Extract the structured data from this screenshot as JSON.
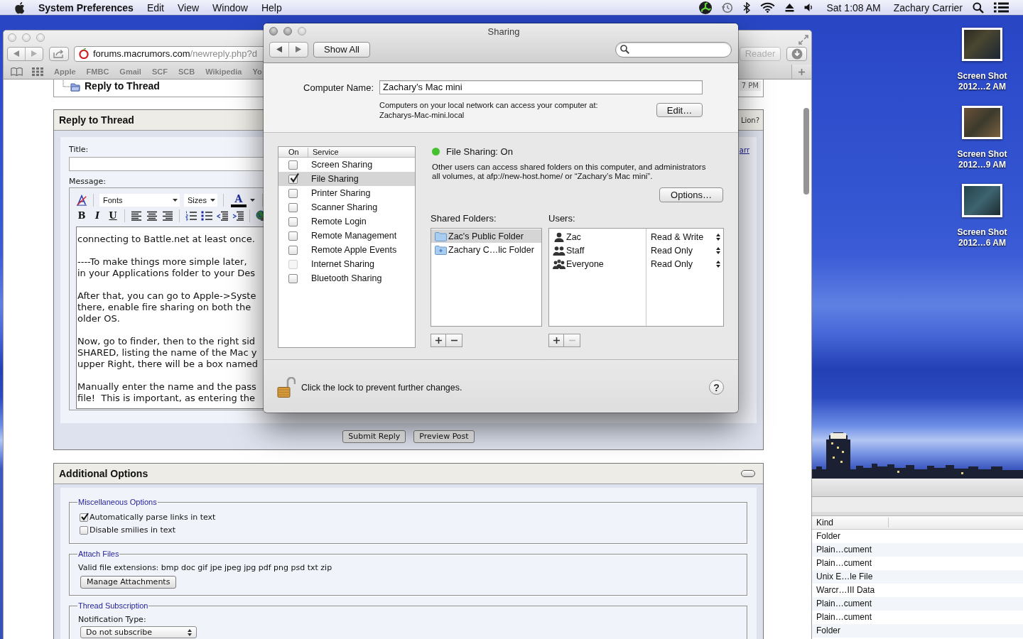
{
  "menu_bar": {
    "app_name": "System Preferences",
    "menus": [
      "Edit",
      "View",
      "Window",
      "Help"
    ],
    "clock": "Sat 1:08 AM",
    "user": "Zachary Carrier"
  },
  "desktop_icons": [
    {
      "name_line": "Screen Shot",
      "date_line": "2012…2 AM"
    },
    {
      "name_line": "Screen Shot",
      "date_line": "2012…9 AM"
    },
    {
      "name_line": "Screen Shot",
      "date_line": "2012…6 AM"
    }
  ],
  "finder": {
    "column": "Kind",
    "rows": [
      "Folder",
      "Plain…cument",
      "Plain…cument",
      "Unix E…le File",
      "Warcr…III Data",
      "Plain…cument",
      "Plain…cument",
      "Folder"
    ]
  },
  "browser": {
    "url_host": "forums.macrumors.com",
    "url_path": "/newreply.php?d",
    "reader_button": "Reader",
    "reader_disabled": true,
    "bookmarks": [
      "Apple",
      "FMBC",
      "Gmail",
      "SCF",
      "SCB",
      "Wikipedia",
      "Yo"
    ],
    "page": {
      "breadcrumb": "Reply to Thread",
      "breadcrumb_time": "7 PM",
      "reply_panel": {
        "title": "Reply to Thread",
        "title_side": "Lion?",
        "side_link": "arr",
        "title_label": "Title:",
        "message_label": "Message:",
        "font_select": "Fonts",
        "size_select": "Sizes",
        "color_button": "A",
        "format_buttons": [
          {
            "label": "B",
            "kind": "bold"
          },
          {
            "label": "I",
            "kind": "italic"
          },
          {
            "label": "U",
            "kind": "underline"
          }
        ],
        "message_paragraphs": [
          [
            "connecting to Battle.net at least once."
          ],
          [
            "----To make things more simple later,",
            "in your Applications folder to your Des"
          ],
          [
            "After that, you can go to Apple->Syste",
            "there, enable fire sharing on both the",
            "older OS."
          ],
          [
            "Now, go to finder, then to the right sid",
            "SHARED, listing the name of the Mac y",
            "upper Right, there will be a box named"
          ],
          [
            "Manually enter the name and the pass",
            "file!  This is important, as entering the"
          ]
        ],
        "buttons": [
          "Submit Reply",
          "Preview Post"
        ]
      },
      "options_panel": {
        "title": "Additional Options",
        "fieldsets": [
          {
            "legend": "Miscellaneous Options",
            "kind": "checkboxes",
            "items": [
              {
                "label": "Automatically parse links in text",
                "checked": true
              },
              {
                "label": "Disable smilies in text",
                "checked": false
              }
            ]
          },
          {
            "legend": "Attach Files",
            "kind": "attachments",
            "text": "Valid file extensions: bmp doc gif jpe jpeg jpg pdf png psd txt zip",
            "button": "Manage Attachments"
          },
          {
            "legend": "Thread Subscription",
            "kind": "subscription",
            "label": "Notification Type:",
            "value": "Do not subscribe"
          }
        ]
      }
    }
  },
  "sharing": {
    "title": "Sharing",
    "show_all": "Show All",
    "computer_name_label": "Computer Name:",
    "computer_name": "Zachary’s Mac mini",
    "address_note": "Computers on your local network can access your computer at:",
    "address": "Zacharys-Mac-mini.local",
    "edit_button": "Edit…",
    "service_columns": [
      "On",
      "Service"
    ],
    "services": [
      {
        "name": "Screen Sharing",
        "checked": false,
        "selected": false,
        "disabled": false
      },
      {
        "name": "File Sharing",
        "checked": true,
        "selected": true,
        "disabled": false
      },
      {
        "name": "Printer Sharing",
        "checked": false,
        "selected": false,
        "disabled": false
      },
      {
        "name": "Scanner Sharing",
        "checked": false,
        "selected": false,
        "disabled": false
      },
      {
        "name": "Remote Login",
        "checked": false,
        "selected": false,
        "disabled": false
      },
      {
        "name": "Remote Management",
        "checked": false,
        "selected": false,
        "disabled": false
      },
      {
        "name": "Remote Apple Events",
        "checked": false,
        "selected": false,
        "disabled": false
      },
      {
        "name": "Internet Sharing",
        "checked": false,
        "selected": false,
        "disabled": true
      },
      {
        "name": "Bluetooth Sharing",
        "checked": false,
        "selected": false,
        "disabled": false
      }
    ],
    "status": {
      "text": "File Sharing: On",
      "on": true
    },
    "description": "Other users can access shared folders on this computer, and administrators all volumes, at afp://new-host.home/ or “Zachary’s Mac mini”.",
    "options_button": "Options…",
    "shared_folders": {
      "label": "Shared Folders:",
      "remove_enabled": true,
      "items": [
        {
          "name": "Zac's Public Folder",
          "kind": "plain",
          "selected": true
        },
        {
          "name": "Zachary C…lic Folder",
          "kind": "badged",
          "selected": false
        }
      ]
    },
    "users": {
      "label": "Users:",
      "remove_enabled": false,
      "items": [
        {
          "name": "Zac",
          "kind": "user",
          "permission": "Read & Write"
        },
        {
          "name": "Staff",
          "kind": "group",
          "permission": "Read Only"
        },
        {
          "name": "Everyone",
          "kind": "everyone",
          "permission": "Read Only"
        }
      ]
    },
    "lock_text": "Click the lock to prevent further changes.",
    "locked": false,
    "help_button": "?"
  }
}
